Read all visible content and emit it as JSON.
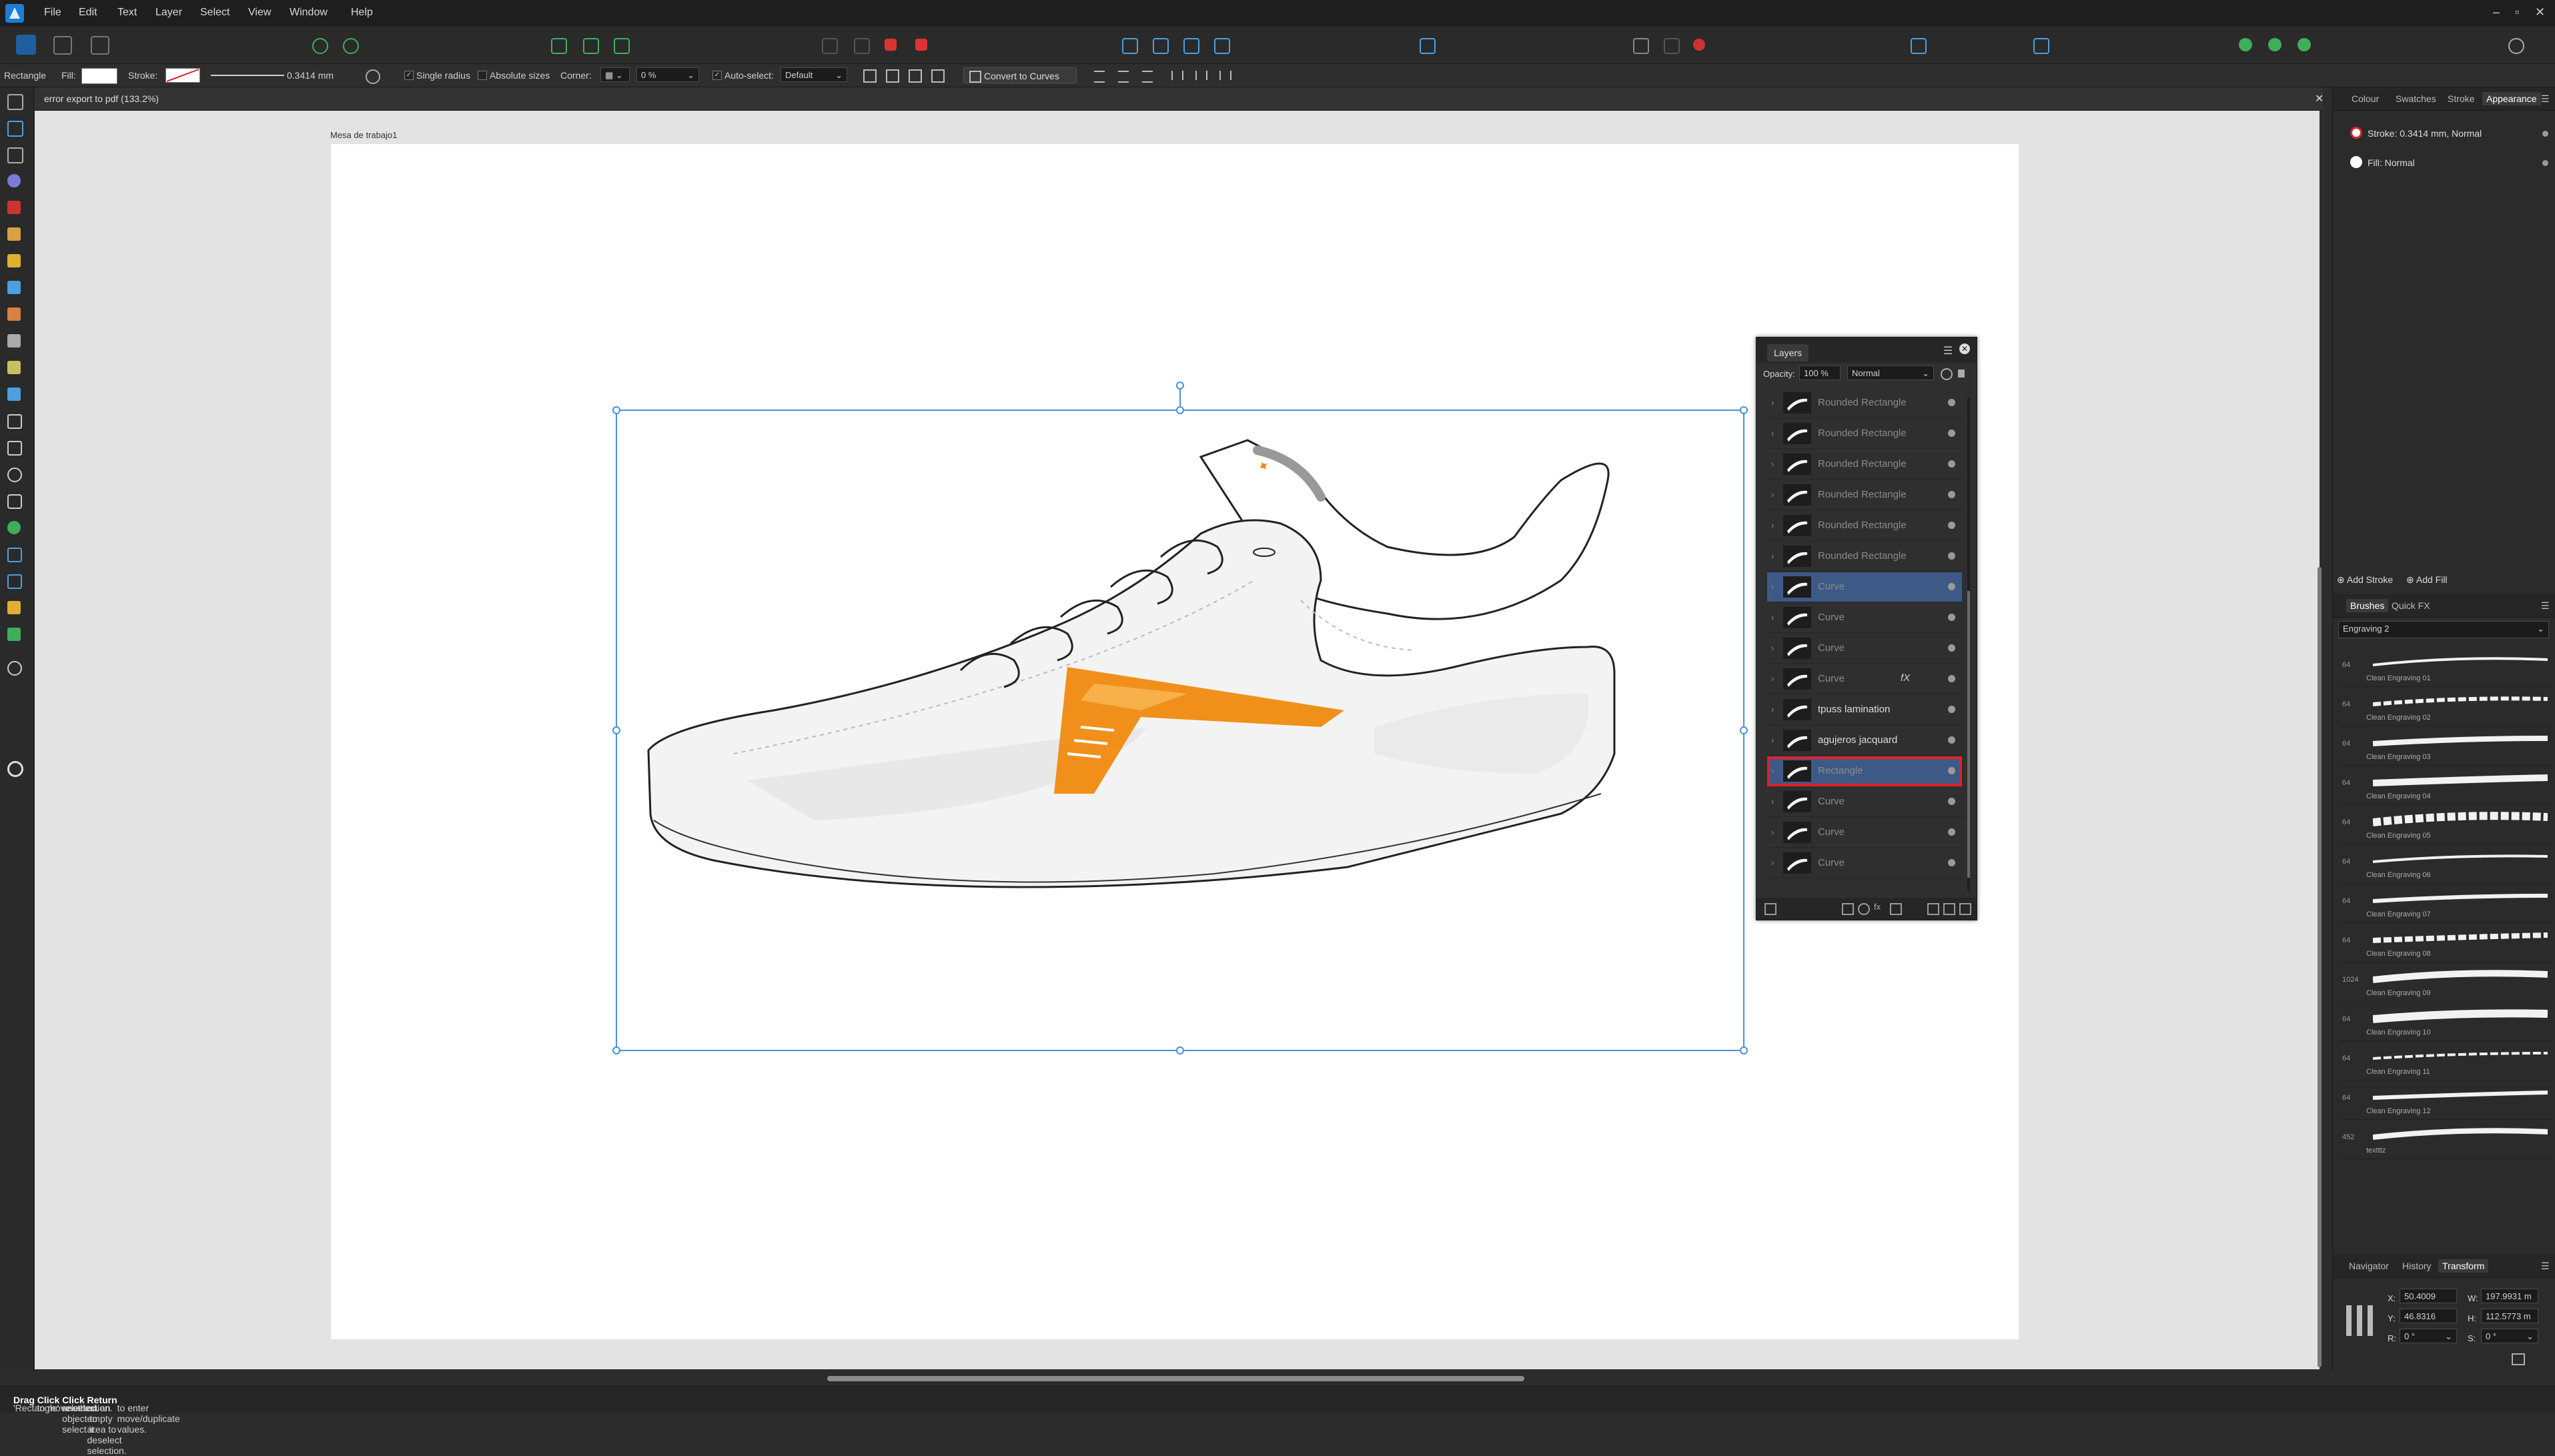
{
  "menu": {
    "items": [
      "File",
      "Edit",
      "Text",
      "Layer",
      "Select",
      "View",
      "Window",
      "Help"
    ]
  },
  "context": {
    "tool_name": "Rectangle",
    "fill_label": "Fill:",
    "stroke_label": "Stroke:",
    "stroke_width": "0.3414 mm",
    "single_radius_label": "Single radius",
    "absolute_sizes_label": "Absolute sizes",
    "corner_label": "Corner:",
    "corner_value": "0 %",
    "auto_select_label": "Auto-select:",
    "auto_select_value": "Default",
    "convert_label": "Convert to Curves"
  },
  "document": {
    "tab_title": "error export to pdf (133.2%)",
    "artboard_name": "Mesa de trabajo1"
  },
  "layers_panel": {
    "tab_label": "Layers",
    "opacity_label": "Opacity:",
    "opacity_value": "100 %",
    "blend_mode": "Normal",
    "rows": [
      {
        "name": "Rounded Rectangle"
      },
      {
        "name": "Rounded Rectangle"
      },
      {
        "name": "Rounded Rectangle"
      },
      {
        "name": "Rounded Rectangle"
      },
      {
        "name": "Rounded Rectangle"
      },
      {
        "name": "Rounded Rectangle"
      },
      {
        "name": "Curve"
      },
      {
        "name": "Curve"
      },
      {
        "name": "Curve"
      },
      {
        "name": "Curve",
        "fx": "fX"
      },
      {
        "name": "tpuss lamination"
      },
      {
        "name": "agujeros jacquard"
      },
      {
        "name": "Rectangle"
      },
      {
        "name": "Curve"
      },
      {
        "name": "Curve"
      },
      {
        "name": "Curve"
      }
    ]
  },
  "appearance": {
    "tabs": [
      "Colour",
      "Swatches",
      "Stroke",
      "Appearance"
    ],
    "active_tab": "Appearance",
    "stroke_entry": "Stroke: 0.3414 mm,  Normal",
    "fill_entry": "Fill:  Normal",
    "add_stroke": "Add Stroke",
    "add_fill": "Add Fill"
  },
  "brushes": {
    "tabs": [
      "Brushes",
      "Quick FX"
    ],
    "category": "Engraving 2",
    "items": [
      {
        "size": "64",
        "name": "Clean Engraving 01"
      },
      {
        "size": "64",
        "name": "Clean Engraving 02"
      },
      {
        "size": "64",
        "name": "Clean Engraving 03"
      },
      {
        "size": "64",
        "name": "Clean Engraving 04"
      },
      {
        "size": "64",
        "name": "Clean Engraving 05"
      },
      {
        "size": "64",
        "name": "Clean Engraving 06"
      },
      {
        "size": "64",
        "name": "Clean Engraving 07"
      },
      {
        "size": "64",
        "name": "Clean Engraving 08"
      },
      {
        "size": "1024",
        "name": "Clean Engraving 09"
      },
      {
        "size": "64",
        "name": "Clean Engraving 10"
      },
      {
        "size": "64",
        "name": "Clean Engraving 11"
      },
      {
        "size": "64",
        "name": "Clean Engraving 12"
      },
      {
        "size": "452",
        "name": "textttz"
      }
    ]
  },
  "transform": {
    "tabs": [
      "Navigator",
      "History",
      "Transform"
    ],
    "active_tab": "Transform",
    "x_label": "X:",
    "x_value": "50.4009 mm",
    "y_label": "Y:",
    "y_value": "46.8316 mm",
    "w_label": "W:",
    "w_value": "197.9931 m",
    "h_label": "H:",
    "h_value": "112.5773 m",
    "r_label": "R:",
    "r_value": "0 °",
    "s_label": "S:",
    "s_value": "0 °"
  },
  "status": {
    "sel": "'Rectangle' selected.",
    "drag": "Drag",
    "drag_rest": "to move selection.",
    "click": "Click",
    "click_rest": "another object to select it.",
    "click2": "Click",
    "click2_rest": "on an empty area to deselect selection.",
    "ret": "Return",
    "ret_rest": "to enter move/duplicate values."
  },
  "colors": {
    "accent": "#1f5f9f",
    "selection": "#3d5a86",
    "highlight": "#e0202a",
    "logo_orange": "#f0901a"
  }
}
